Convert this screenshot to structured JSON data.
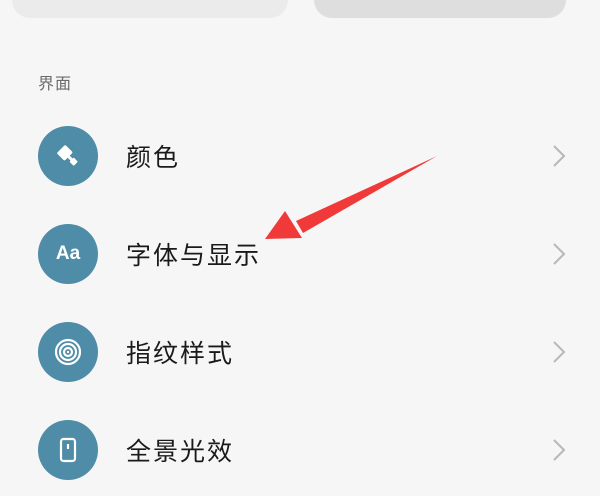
{
  "section": {
    "title": "界面"
  },
  "items": [
    {
      "label": "颜色",
      "icon": "paint-roller-icon"
    },
    {
      "label": "字体与显示",
      "icon": "font-aa-icon",
      "icon_text": "Aa"
    },
    {
      "label": "指纹样式",
      "icon": "fingerprint-icon"
    },
    {
      "label": "全景光效",
      "icon": "phone-light-icon"
    }
  ],
  "colors": {
    "icon_bg": "#4e8ca7",
    "arrow": "#f03a3a",
    "background": "#f6f6f6"
  }
}
